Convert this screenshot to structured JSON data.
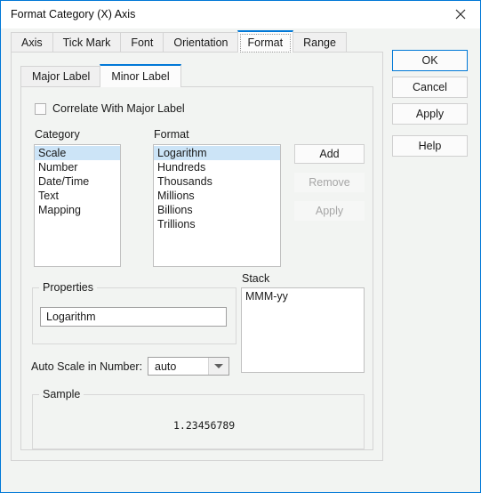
{
  "window": {
    "title": "Format Category (X) Axis",
    "close_icon": "close-icon",
    "accent_color": "#0078d7",
    "background_color": "#f2f4f2"
  },
  "tabs": [
    {
      "label": "Axis",
      "active": false
    },
    {
      "label": "Tick Mark",
      "active": false
    },
    {
      "label": "Font",
      "active": false
    },
    {
      "label": "Orientation",
      "active": false
    },
    {
      "label": "Format",
      "active": true
    },
    {
      "label": "Range",
      "active": false
    }
  ],
  "subtabs": [
    {
      "label": "Major Label",
      "active": false
    },
    {
      "label": "Minor Label",
      "active": true
    }
  ],
  "correlate": {
    "label": "Correlate With Major Label",
    "checked": false
  },
  "category": {
    "label": "Category",
    "items": [
      "Scale",
      "Number",
      "Date/Time",
      "Text",
      "Mapping"
    ],
    "selected": "Scale"
  },
  "format": {
    "label": "Format",
    "items": [
      "Logarithm",
      "Hundreds",
      "Thousands",
      "Millions",
      "Billions",
      "Trillions"
    ],
    "selected": "Logarithm"
  },
  "list_buttons": {
    "add": "Add",
    "remove": "Remove",
    "apply": "Apply"
  },
  "properties": {
    "label": "Properties",
    "value": "Logarithm"
  },
  "stack": {
    "label": "Stack",
    "items": [
      "MMM-yy"
    ]
  },
  "auto_scale": {
    "label": "Auto Scale in Number:",
    "value": "auto",
    "options": [
      "auto"
    ]
  },
  "sample": {
    "label": "Sample",
    "value": "1.23456789"
  },
  "dialog_buttons": {
    "ok": "OK",
    "cancel": "Cancel",
    "apply": "Apply",
    "help": "Help"
  }
}
